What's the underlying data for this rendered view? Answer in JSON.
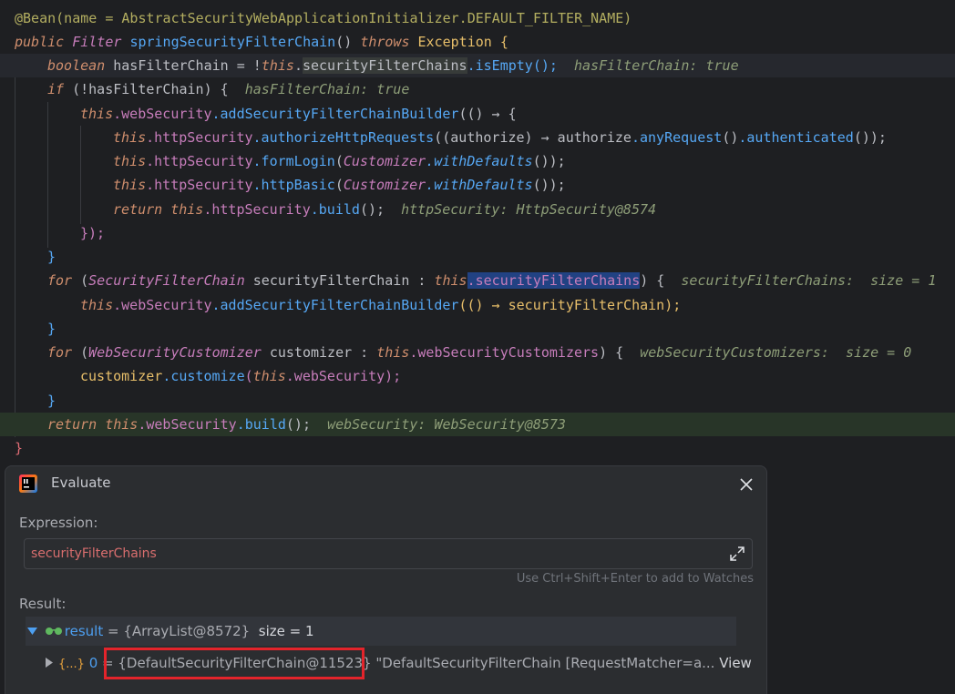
{
  "editor": {
    "lines": [
      {
        "annotation": "@Bean(name = AbstractSecurityWebApplicationInitializer.DEFAULT_FILTER_NAME)"
      },
      {
        "signature_kw": "public",
        "signature_type": "Filter",
        "signature_method": "springSecurityFilterChain",
        "signature_rest": "() ",
        "throws_kw": "throws",
        "exception": "Exception",
        "brace": " {"
      },
      {
        "bool_kw": "boolean",
        "var": " hasFilterChain = !",
        "this_kw": "this",
        "dot": ".",
        "field": "securityFilterChains",
        "call": ".isEmpty();",
        "hint": "hasFilterChain: true"
      },
      {
        "if_kw": "if",
        "cond": " (!hasFilterChain) {",
        "hint": "hasFilterChain: true"
      },
      {
        "this_kw": "this",
        "field": ".webSecurity",
        "method": ".addSecurityFilterChainBuilder",
        "rest": "(() → {"
      },
      {
        "this_kw": "this",
        "field": ".httpSecurity",
        "method": ".authorizeHttpRequests",
        "rest_a": "((authorize) → authorize",
        "method2": ".anyRequest",
        "rest_b": "()",
        "method3": ".authenticated",
        "rest_c": "());"
      },
      {
        "this_kw": "this",
        "field": ".httpSecurity",
        "method": ".formLogin",
        "open": "(",
        "static_cls": "Customizer",
        "static_m": ".withDefaults",
        "close": "());"
      },
      {
        "this_kw": "this",
        "field": ".httpSecurity",
        "method": ".httpBasic",
        "open": "(",
        "static_cls": "Customizer",
        "static_m": ".withDefaults",
        "close": "());"
      },
      {
        "return_kw": "return",
        "this_kw": " this",
        "field": ".httpSecurity",
        "method": ".build",
        "rest": "();",
        "hint": "httpSecurity: HttpSecurity@8574"
      },
      {
        "text": "});"
      },
      {
        "text": "}"
      },
      {
        "for_kw": "for",
        "open": " (",
        "type": "SecurityFilterChain",
        "var": " securityFilterChain : ",
        "this_kw": "this",
        "field": ".securityFilterChains",
        "close": ") {",
        "hint": "securityFilterChains:  size = 1"
      },
      {
        "this_kw": "this",
        "field": ".webSecurity",
        "method": ".addSecurityFilterChainBuilder",
        "rest": "(() → securityFilterChain);"
      },
      {
        "text": "}"
      },
      {
        "for_kw": "for",
        "open": " (",
        "type": "WebSecurityCustomizer",
        "var": " customizer : ",
        "this_kw": "this",
        "field": ".webSecurityCustomizers",
        "close": ") {",
        "hint": "webSecurityCustomizers:  size = 0"
      },
      {
        "pre": "customizer",
        "method": ".customize",
        "open": "(",
        "this_kw": "this",
        "field": ".webSecurity",
        "close": ");"
      },
      {
        "text": "}"
      },
      {
        "return_kw": "return",
        "this_kw": " this",
        "field": ".webSecurity",
        "method": ".build",
        "rest": "();",
        "hint": "webSecurity: WebSecurity@8573"
      },
      {
        "text": "}"
      }
    ]
  },
  "dialog": {
    "title": "Evaluate",
    "expression_label": "Expression:",
    "expression_value": "securityFilterChains",
    "watch_hint": "Use Ctrl+Shift+Enter to add to Watches",
    "result_label": "Result:",
    "result_row": {
      "name": "result",
      "eq": " = ",
      "value": "{ArrayList@8572}",
      "size": "size = 1"
    },
    "child_row": {
      "badge": "{...}",
      "index": "0",
      "eq": " = ",
      "value": "{DefaultSecurityFilterChain@11523}",
      "desc": "\"DefaultSecurityFilterChain [RequestMatcher=a...",
      "view_link": "View"
    }
  },
  "colors": {
    "editor_bg": "#1e1f22",
    "dialog_bg": "#2b2d30",
    "highlight_box": "#e3242b",
    "breakpoint_line": "#283528"
  }
}
